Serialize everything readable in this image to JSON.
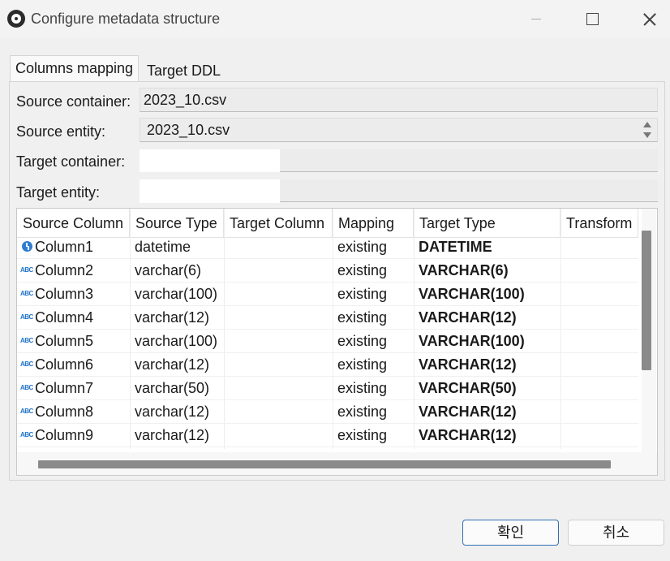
{
  "window": {
    "title": "Configure metadata structure"
  },
  "tabs": [
    {
      "label": "Columns mapping",
      "active": true
    },
    {
      "label": "Target DDL",
      "active": false
    }
  ],
  "form": {
    "source_container_label": "Source container:",
    "source_container_value": "2023_10.csv",
    "source_entity_label": "Source entity:",
    "source_entity_value": "2023_10.csv",
    "target_container_label": "Target container:",
    "target_container_value": "",
    "target_entity_label": "Target entity:",
    "target_entity_value": ""
  },
  "table": {
    "columns": [
      "Source Column",
      "Source Type",
      "Target Column",
      "Mapping",
      "Target Type",
      "Transform"
    ],
    "rows": [
      {
        "icon": "clock-icon",
        "source_column": "Column1",
        "source_type": "datetime",
        "target_column": "",
        "mapping": "existing",
        "target_type": "DATETIME",
        "transform": ""
      },
      {
        "icon": "abc-icon",
        "source_column": "Column2",
        "source_type": "varchar(6)",
        "target_column": "",
        "mapping": "existing",
        "target_type": "VARCHAR(6)",
        "transform": ""
      },
      {
        "icon": "abc-icon",
        "source_column": "Column3",
        "source_type": "varchar(100)",
        "target_column": "",
        "mapping": "existing",
        "target_type": "VARCHAR(100)",
        "transform": ""
      },
      {
        "icon": "abc-icon",
        "source_column": "Column4",
        "source_type": "varchar(12)",
        "target_column": "",
        "mapping": "existing",
        "target_type": "VARCHAR(12)",
        "transform": ""
      },
      {
        "icon": "abc-icon",
        "source_column": "Column5",
        "source_type": "varchar(100)",
        "target_column": "",
        "mapping": "existing",
        "target_type": "VARCHAR(100)",
        "transform": ""
      },
      {
        "icon": "abc-icon",
        "source_column": "Column6",
        "source_type": "varchar(12)",
        "target_column": "",
        "mapping": "existing",
        "target_type": "VARCHAR(12)",
        "transform": ""
      },
      {
        "icon": "abc-icon",
        "source_column": "Column7",
        "source_type": "varchar(50)",
        "target_column": "",
        "mapping": "existing",
        "target_type": "VARCHAR(50)",
        "transform": ""
      },
      {
        "icon": "abc-icon",
        "source_column": "Column8",
        "source_type": "varchar(12)",
        "target_column": "",
        "mapping": "existing",
        "target_type": "VARCHAR(12)",
        "transform": ""
      },
      {
        "icon": "abc-icon",
        "source_column": "Column9",
        "source_type": "varchar(12)",
        "target_column": "",
        "mapping": "existing",
        "target_type": "VARCHAR(12)",
        "transform": ""
      }
    ]
  },
  "buttons": {
    "ok_label": "확인",
    "cancel_label": "취소"
  },
  "icons": {
    "abc_text": "ABC"
  },
  "colors": {
    "accent": "#2f6fb3",
    "type_icon": "#1e73c8"
  }
}
